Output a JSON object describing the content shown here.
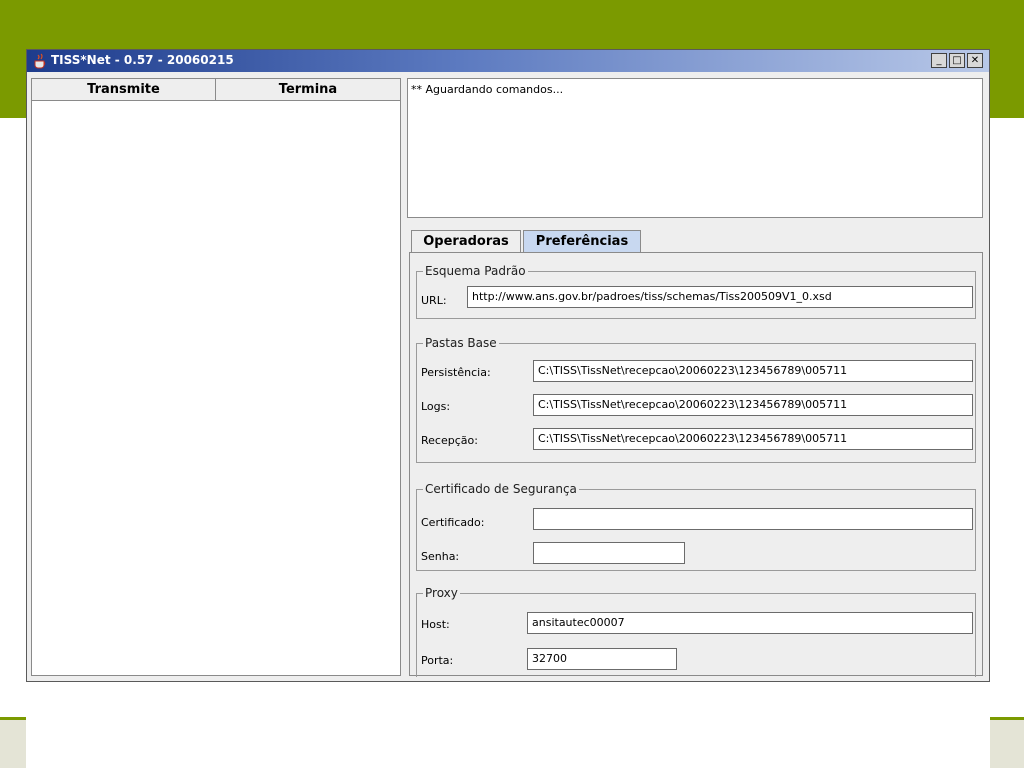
{
  "window": {
    "title": "TISS*Net - 0.57 - 20060215",
    "minimize_label": "_",
    "maximize_label": "□",
    "close_label": "✕"
  },
  "table": {
    "columns": [
      "Transmite",
      "Termina"
    ]
  },
  "log": {
    "text": "** Aguardando comandos..."
  },
  "tabs": [
    {
      "label": "Operadoras",
      "active": false
    },
    {
      "label": "Preferências",
      "active": true
    }
  ],
  "esquema": {
    "legend": "Esquema Padrão",
    "url_label": "URL:",
    "url_value": "http://www.ans.gov.br/padroes/tiss/schemas/Tiss200509V1_0.xsd"
  },
  "pastas": {
    "legend": "Pastas Base",
    "persistencia_label": "Persistência:",
    "persistencia_value": "C:\\TISS\\TissNet\\recepcao\\20060223\\123456789\\005711",
    "logs_label": "Logs:",
    "logs_value": "C:\\TISS\\TissNet\\recepcao\\20060223\\123456789\\005711",
    "recepcao_label": "Recepção:",
    "recepcao_value": "C:\\TISS\\TissNet\\recepcao\\20060223\\123456789\\005711"
  },
  "certificado": {
    "legend": "Certificado de Segurança",
    "certificado_label": "Certificado:",
    "certificado_value": "",
    "senha_label": "Senha:",
    "senha_value": ""
  },
  "proxy": {
    "legend": "Proxy",
    "host_label": "Host:",
    "host_value": "ansitautec00007",
    "porta_label": "Porta:",
    "porta_value": "32700"
  },
  "colors": {
    "slide_green": "#7b9a00",
    "titlebar_dark": "#1e3c8c",
    "active_tab": "#c8d8f0"
  }
}
